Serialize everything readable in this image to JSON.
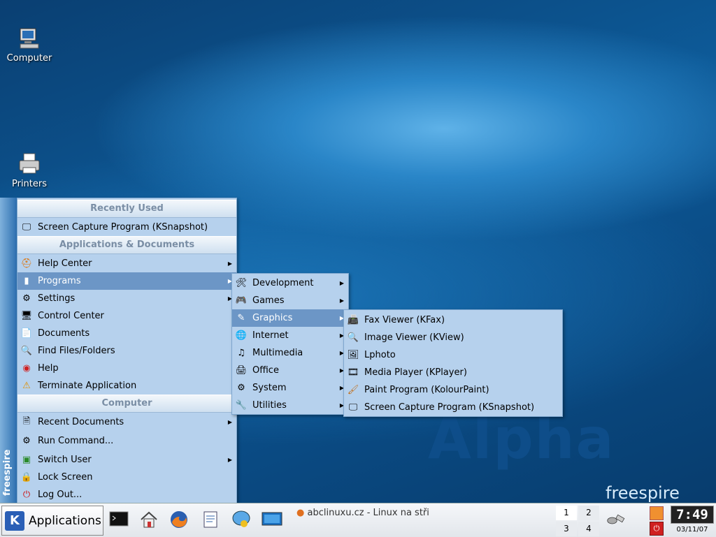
{
  "desktop": {
    "icons": [
      {
        "label": "Computer",
        "icon": "computer-icon"
      },
      {
        "label": "Printers",
        "icon": "printer-icon"
      }
    ],
    "watermark": "Alpha",
    "brand": "freespire"
  },
  "main_menu": {
    "sidebar_text": "freespire",
    "sections": {
      "recent": "Recently Used",
      "apps": "Applications & Documents",
      "computer": "Computer"
    },
    "recent_items": [
      {
        "label": "Screen Capture Program (KSnapshot)",
        "icon": "screen-capture-icon"
      }
    ],
    "app_items": [
      {
        "label": "Help Center",
        "icon": "help-center-icon",
        "submenu": true
      },
      {
        "label": "Programs",
        "icon": "programs-icon",
        "submenu": true,
        "active": true
      },
      {
        "label": "Settings",
        "icon": "settings-icon",
        "submenu": true
      },
      {
        "label": "Control Center",
        "icon": "control-center-icon",
        "submenu": false
      },
      {
        "label": "Documents",
        "icon": "documents-icon",
        "submenu": false
      },
      {
        "label": "Find Files/Folders",
        "icon": "find-icon",
        "submenu": false
      },
      {
        "label": "Help",
        "icon": "help-icon",
        "submenu": false
      },
      {
        "label": "Terminate Application",
        "icon": "warning-icon",
        "submenu": false
      }
    ],
    "computer_items": [
      {
        "label": "Recent Documents",
        "icon": "recent-documents-icon",
        "submenu": true
      },
      {
        "label": "Run Command...",
        "icon": "run-command-icon",
        "submenu": false
      },
      {
        "label": "Switch User",
        "icon": "switch-user-icon",
        "submenu": true
      },
      {
        "label": "Lock Screen",
        "icon": "lock-icon",
        "submenu": false
      },
      {
        "label": "Log Out...",
        "icon": "logout-icon",
        "submenu": false
      }
    ]
  },
  "programs_menu": {
    "items": [
      {
        "label": "Development",
        "icon": "development-icon"
      },
      {
        "label": "Games",
        "icon": "games-icon"
      },
      {
        "label": "Graphics",
        "icon": "graphics-icon",
        "active": true
      },
      {
        "label": "Internet",
        "icon": "internet-icon"
      },
      {
        "label": "Multimedia",
        "icon": "multimedia-icon"
      },
      {
        "label": "Office",
        "icon": "office-icon"
      },
      {
        "label": "System",
        "icon": "system-icon"
      },
      {
        "label": "Utilities",
        "icon": "utilities-icon"
      }
    ]
  },
  "graphics_menu": {
    "items": [
      {
        "label": "Fax Viewer (KFax)",
        "icon": "fax-icon"
      },
      {
        "label": "Image Viewer (KView)",
        "icon": "image-viewer-icon"
      },
      {
        "label": "Lphoto",
        "icon": "photo-icon"
      },
      {
        "label": "Media Player (KPlayer)",
        "icon": "media-player-icon"
      },
      {
        "label": "Paint Program (KolourPaint)",
        "icon": "paint-icon"
      },
      {
        "label": "Screen Capture Program (KSnapshot)",
        "icon": "screen-capture-icon"
      }
    ]
  },
  "taskbar": {
    "applications_label": "Applications",
    "task_label": "abclinuxu.cz - Linux na stři",
    "pager": [
      "1",
      "2",
      "3",
      "4"
    ],
    "time": "7:49",
    "date": "03/11/07"
  }
}
